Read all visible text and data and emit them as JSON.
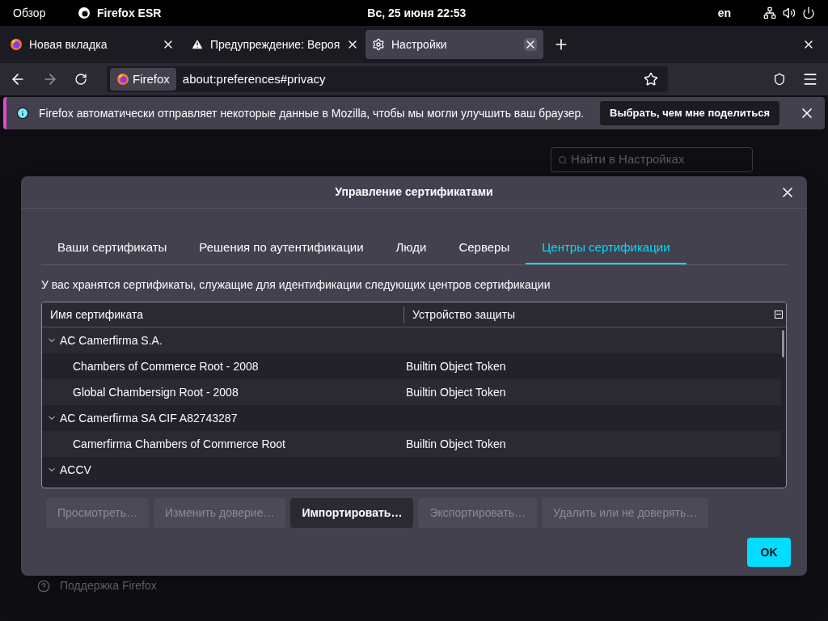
{
  "top_bar": {
    "activities": "Обзор",
    "app": "Firefox ESR",
    "clock": "Вс, 25 июня  22:53",
    "language": "en"
  },
  "tabs": [
    {
      "title": "Новая вкладка",
      "kind": "firefox",
      "selected": false
    },
    {
      "title": "Предупреждение: Вероя",
      "kind": "warning",
      "selected": false
    },
    {
      "title": "Настройки",
      "kind": "settings",
      "selected": true
    }
  ],
  "nav": {
    "identity": "Firefox",
    "url": "about:preferences#privacy"
  },
  "notification": {
    "text": "Firefox автоматически отправляет некоторые данные в Mozilla, чтобы мы могли улучшить ваш браузер.",
    "button": "Выбрать, чем мне поделиться"
  },
  "page": {
    "search_placeholder": "Найти в Настройках",
    "support_link": "Поддержка Firefox"
  },
  "dialog": {
    "title": "Управление сертификатами",
    "tabs": [
      {
        "label": "Ваши сертификаты",
        "selected": false
      },
      {
        "label": "Решения по аутентификации",
        "selected": false
      },
      {
        "label": "Люди",
        "selected": false
      },
      {
        "label": "Серверы",
        "selected": false
      },
      {
        "label": "Центры сертификации",
        "selected": true
      }
    ],
    "description": "У вас хранятся сертификаты, служащие для идентификации следующих центров сертификации",
    "columns": [
      "Имя сертификата",
      "Устройство защиты"
    ],
    "tree": [
      {
        "name": "AC Camerfirma S.A.",
        "expanded": true,
        "children": [
          {
            "name": "Chambers of Commerce Root - 2008",
            "device": "Builtin Object Token"
          },
          {
            "name": "Global Chambersign Root - 2008",
            "device": "Builtin Object Token"
          }
        ]
      },
      {
        "name": "AC Camerfirma SA CIF A82743287",
        "expanded": true,
        "children": [
          {
            "name": "Camerfirma Chambers of Commerce Root",
            "device": "Builtin Object Token"
          }
        ]
      },
      {
        "name": "ACCV",
        "expanded": true
      }
    ],
    "buttons": [
      {
        "label": "Просмотреть…",
        "disabled": true
      },
      {
        "label": "Изменить доверие…",
        "disabled": true
      },
      {
        "label": "Импортировать…",
        "disabled": false
      },
      {
        "label": "Экспортировать…",
        "disabled": true
      },
      {
        "label": "Удалить или не доверять…",
        "disabled": true
      }
    ],
    "ok": "OK"
  }
}
